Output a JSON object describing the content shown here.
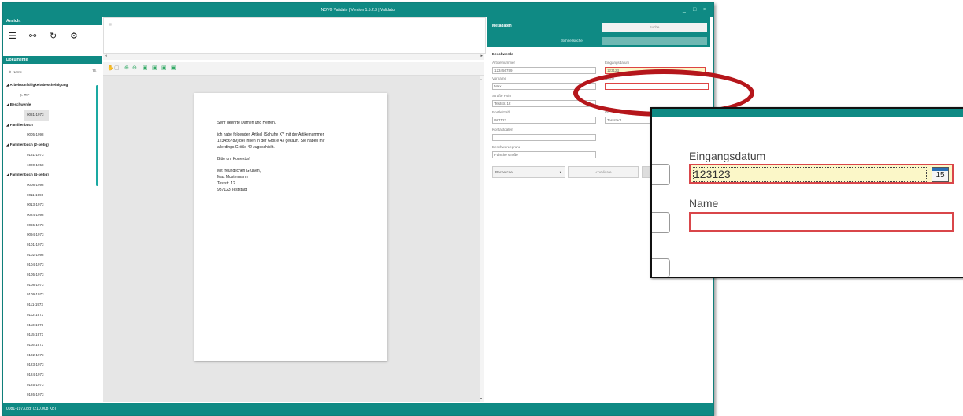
{
  "window": {
    "title": "NOVO Validate | Version 1.5.2.3 | Validator",
    "controls": {
      "minimize": "_",
      "maximize": "□",
      "close": "×"
    }
  },
  "left": {
    "view_header": "Ansicht",
    "docs_header": "Dokumente",
    "search_placeholder": "Name",
    "tree": [
      {
        "label": "Arbeitsunfähigkeitsbescheinigung",
        "level": 0
      },
      {
        "label": "TIF",
        "level": 1
      },
      {
        "label": "Beschwerde",
        "level": 0
      },
      {
        "label": "0081-1973",
        "level": 1,
        "selected": true
      },
      {
        "label": "Familienbuch",
        "level": 0
      },
      {
        "label": "0005-1998",
        "level": 1
      },
      {
        "label": "Familienbuch (2-seitig)",
        "level": 0
      },
      {
        "label": "0181-1973",
        "level": 1
      },
      {
        "label": "1020-1958",
        "level": 1
      },
      {
        "label": "Familienbuch (4-seitig)",
        "level": 0
      },
      {
        "label": "0008-1998",
        "level": 1
      },
      {
        "label": "0011-1998",
        "level": 1
      },
      {
        "label": "0013-1973",
        "level": 1
      },
      {
        "label": "0024-1998",
        "level": 1
      },
      {
        "label": "0065-1973",
        "level": 1
      },
      {
        "label": "0094-1973",
        "level": 1
      },
      {
        "label": "0101-1973",
        "level": 1
      },
      {
        "label": "0102-1998",
        "level": 1
      },
      {
        "label": "0104-1973",
        "level": 1
      },
      {
        "label": "0105-1973",
        "level": 1
      },
      {
        "label": "0108-1973",
        "level": 1
      },
      {
        "label": "0109-1973",
        "level": 1
      },
      {
        "label": "0111-1973",
        "level": 1
      },
      {
        "label": "0112-1973",
        "level": 1
      },
      {
        "label": "0113-1973",
        "level": 1
      },
      {
        "label": "0115-1973",
        "level": 1
      },
      {
        "label": "0116-1973",
        "level": 1
      },
      {
        "label": "0122-1973",
        "level": 1
      },
      {
        "label": "0123-1973",
        "level": 1
      },
      {
        "label": "0124-1973",
        "level": 1
      },
      {
        "label": "0125-1973",
        "level": 1
      },
      {
        "label": "0126-1973",
        "level": 1
      }
    ]
  },
  "status": "0081-1973.pdf (210,008 KB)",
  "document": {
    "lines": [
      "Sehr geehrte Damen und Herren,",
      "ich habe folgenden Artikel (Schuhe XY mit der Artikelnummer",
      "123456789) bei Ihnen in der Größe 43 gekauft. Sie haben mir",
      "allerdings Größe 42 zugeschickt.",
      "Bitte um Korrektur!",
      "Mit freundlichen Grüßen,",
      "Max Mustermann",
      "Teststr. 12",
      "987123 Teststadt"
    ]
  },
  "meta": {
    "header": "Metadaten",
    "search_button": "Suche",
    "quick_search_label": "Schnellsuche",
    "section": "Beschwerde",
    "fields": {
      "artikelnummer": {
        "label": "Artikelnummer",
        "value": "123456789"
      },
      "eingangsdatum": {
        "label": "Eingangsdatum",
        "value": "123123"
      },
      "vorname": {
        "label": "Vorname",
        "value": "Max"
      },
      "name": {
        "label": "Name",
        "value": ""
      },
      "strasse": {
        "label": "Straße Hsfn",
        "value": "Teststr. 12"
      },
      "plz": {
        "label": "Postleitzahl",
        "value": "987123"
      },
      "ort": {
        "label": "Ort",
        "value": "Teststadt"
      },
      "kontakt": {
        "label": "Kontaktdaten",
        "value": ""
      },
      "grund": {
        "label": "Beschwerdegrund",
        "value": "Falsche Größe"
      }
    },
    "recherche": "Recherche",
    "validate": "Validate"
  },
  "zoom": {
    "eingangsdatum_label": "Eingangsdatum",
    "eingangsdatum_value": "123123",
    "calendar_day": "15",
    "name_label": "Name"
  },
  "colors": {
    "teal": "#0f8a84",
    "highlight": "#fbf7c8",
    "error": "#d9464a",
    "annotation": "#b5161b"
  }
}
